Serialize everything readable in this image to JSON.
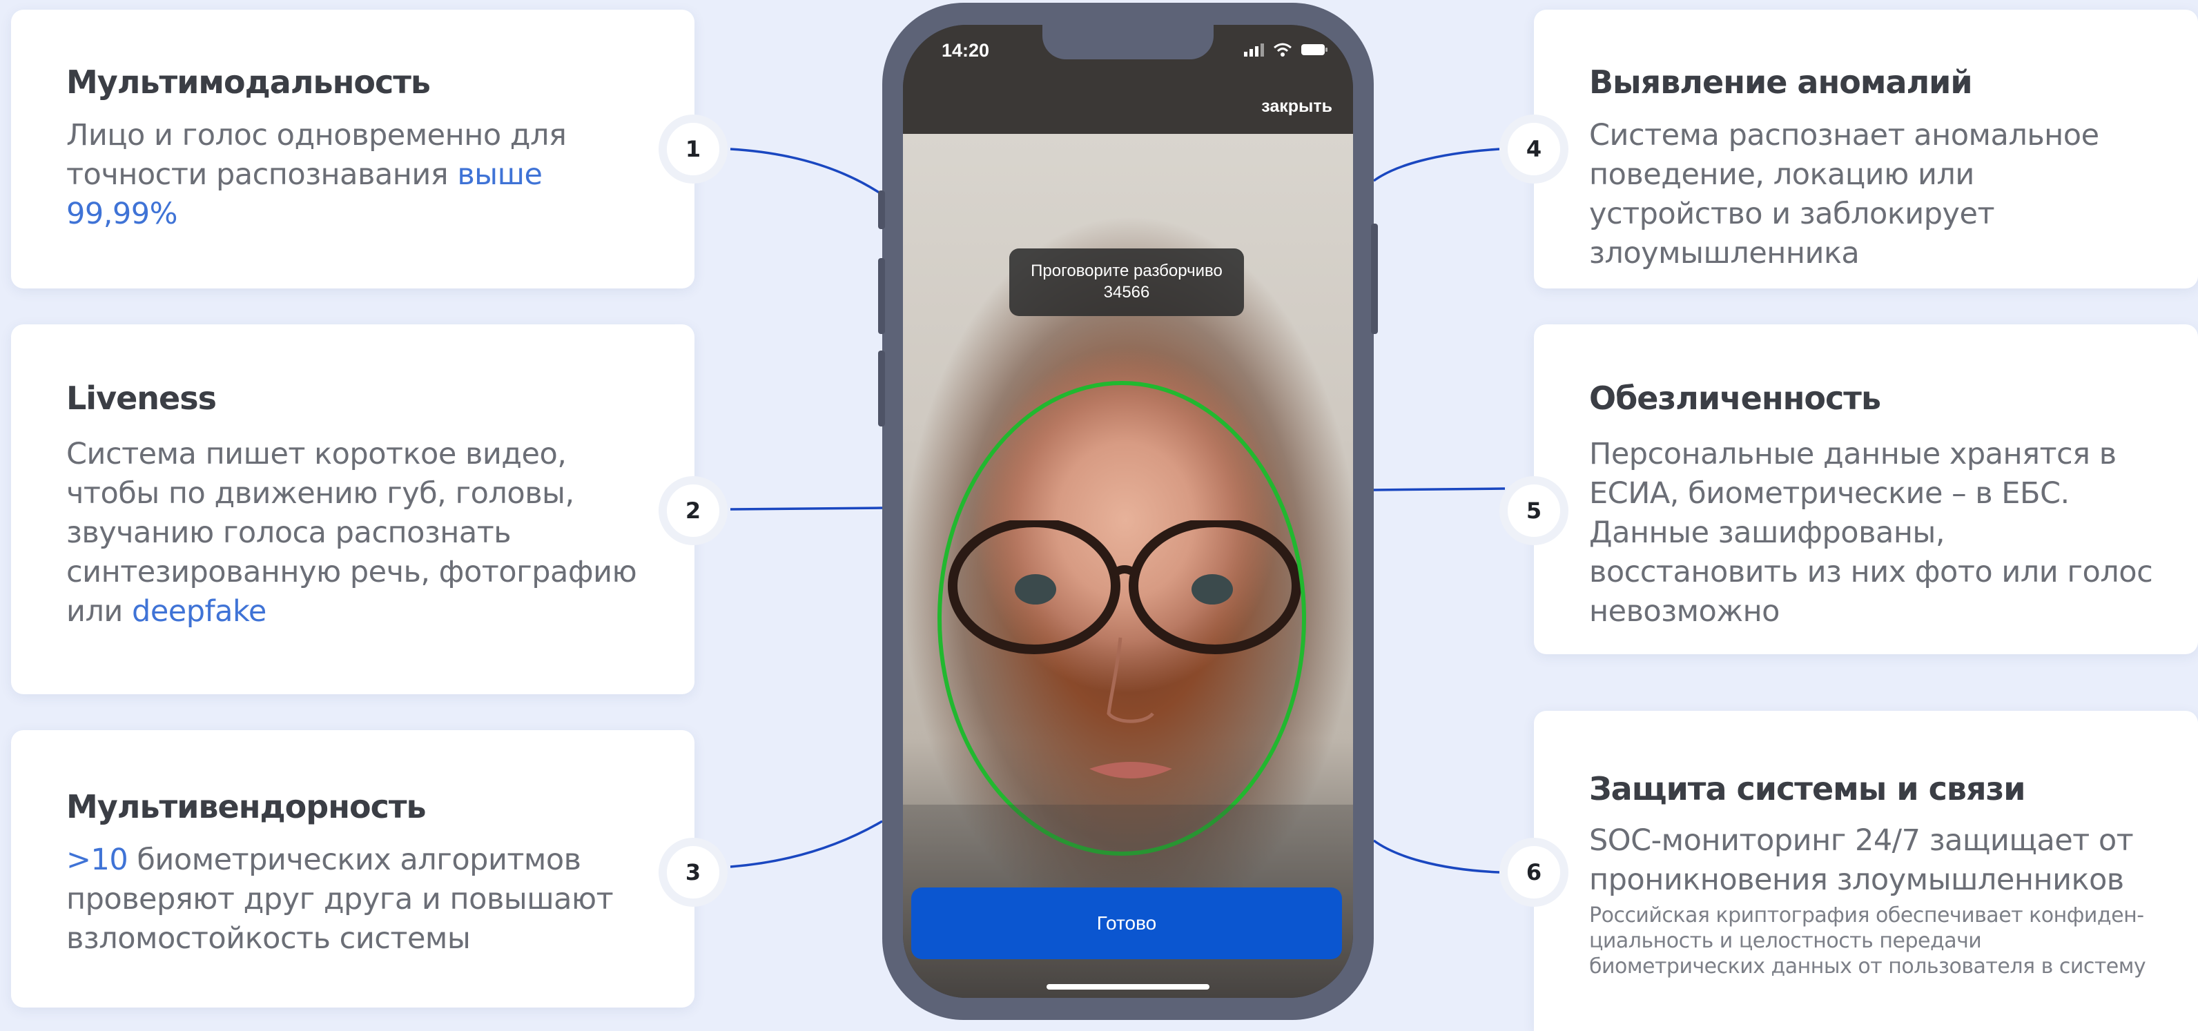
{
  "features": [
    {
      "number": "1",
      "title": "Мультимодальность",
      "text": "Лицо и голос одновременно для точности распознавания ",
      "accent": "выше 99,99%"
    },
    {
      "number": "2",
      "title": "Liveness",
      "text": "Система пишет короткое видео, чтобы по движению губ, головы, звучанию голоса распознать синтезированную речь, фотографию или ",
      "accent": "deepfake"
    },
    {
      "number": "3",
      "title": "Мультивендорность",
      "accent": ">10",
      "text": " биометрических алгоритмов проверяют друг друга и повышают взломостойкость системы"
    },
    {
      "number": "4",
      "title": "Выявление аномалий",
      "text": "Система распознает аномальное поведение, локацию или устройство и заблокирует злоумышленника"
    },
    {
      "number": "5",
      "title": "Обезличенность",
      "text": "Персональные данные хранятся в ЕСИА, биометрические – в ЕБС. Данные зашифрованы, восстановить из них фото или голос невозможно"
    },
    {
      "number": "6",
      "title": "Защита системы и связи",
      "text": "SOC-мониторинг 24/7 защищает от проникновения злоумышленников",
      "small": "Российская криптография обеспечивает конфиден-циальность и целостность передачи биометрических данных  от пользователя в систему"
    }
  ],
  "phone": {
    "time": "14:20",
    "close_label": "закрыть",
    "prompt_line1": "Проговорите разборчиво",
    "prompt_code": "34566",
    "done_label": "Готово",
    "icons": [
      "signal-icon",
      "wifi-icon",
      "battery-icon"
    ]
  },
  "colors": {
    "accent": "#3f73d6",
    "button": "#0b56d0",
    "face_oval": "#21b82f",
    "connector": "#1a47c0"
  }
}
